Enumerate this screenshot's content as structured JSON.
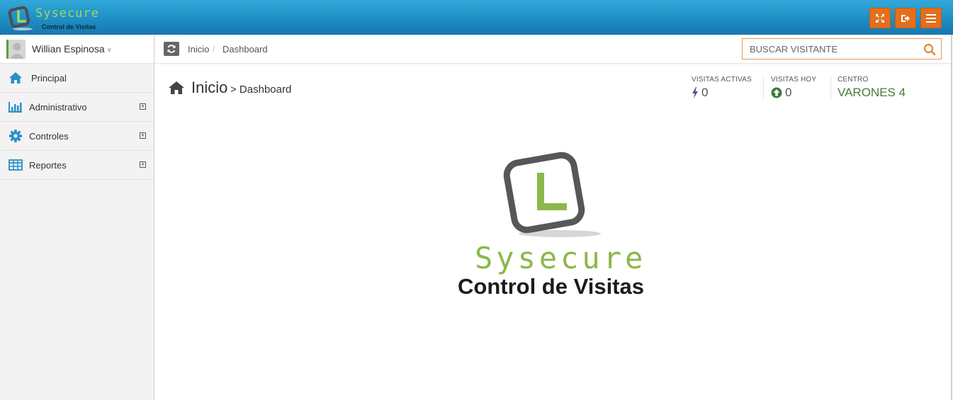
{
  "brand": {
    "name": "Sysecure",
    "subtitle": "Control de Visitas"
  },
  "navbar": {
    "buttons": [
      {
        "icon": "fullscreen-icon"
      },
      {
        "icon": "logout-icon"
      },
      {
        "icon": "menu-icon"
      }
    ],
    "button_color": "#e36f1c",
    "bar_color": "#1e8fc6"
  },
  "user": {
    "name": "Willian Espinosa"
  },
  "sidebar": {
    "items": [
      {
        "label": "Principal",
        "icon": "home-icon",
        "expandable": false
      },
      {
        "label": "Administrativo",
        "icon": "bar-chart-icon",
        "expandable": true
      },
      {
        "label": "Controles",
        "icon": "gear-icon",
        "expandable": true
      },
      {
        "label": "Reportes",
        "icon": "table-icon",
        "expandable": true
      }
    ]
  },
  "breadcrumb": {
    "items": [
      "Inicio",
      "Dashboard"
    ],
    "separator": "/"
  },
  "search": {
    "placeholder": "BUSCAR VISITANTE"
  },
  "page": {
    "title": "Inicio",
    "subtitle": "> Dashboard"
  },
  "stats": {
    "active": {
      "caption": "VISITAS ACTIVAS",
      "value": "0"
    },
    "today": {
      "caption": "VISITAS HOY",
      "value": "0"
    },
    "center": {
      "caption": "CENTRO",
      "value": "VARONES 4"
    }
  },
  "logo": {
    "name": "Sysecure",
    "subtitle": "Control de Visitas"
  },
  "colors": {
    "accent_green": "#8bb84a",
    "accent_orange": "#e36f1c",
    "stat_green": "#4a7a3a"
  }
}
